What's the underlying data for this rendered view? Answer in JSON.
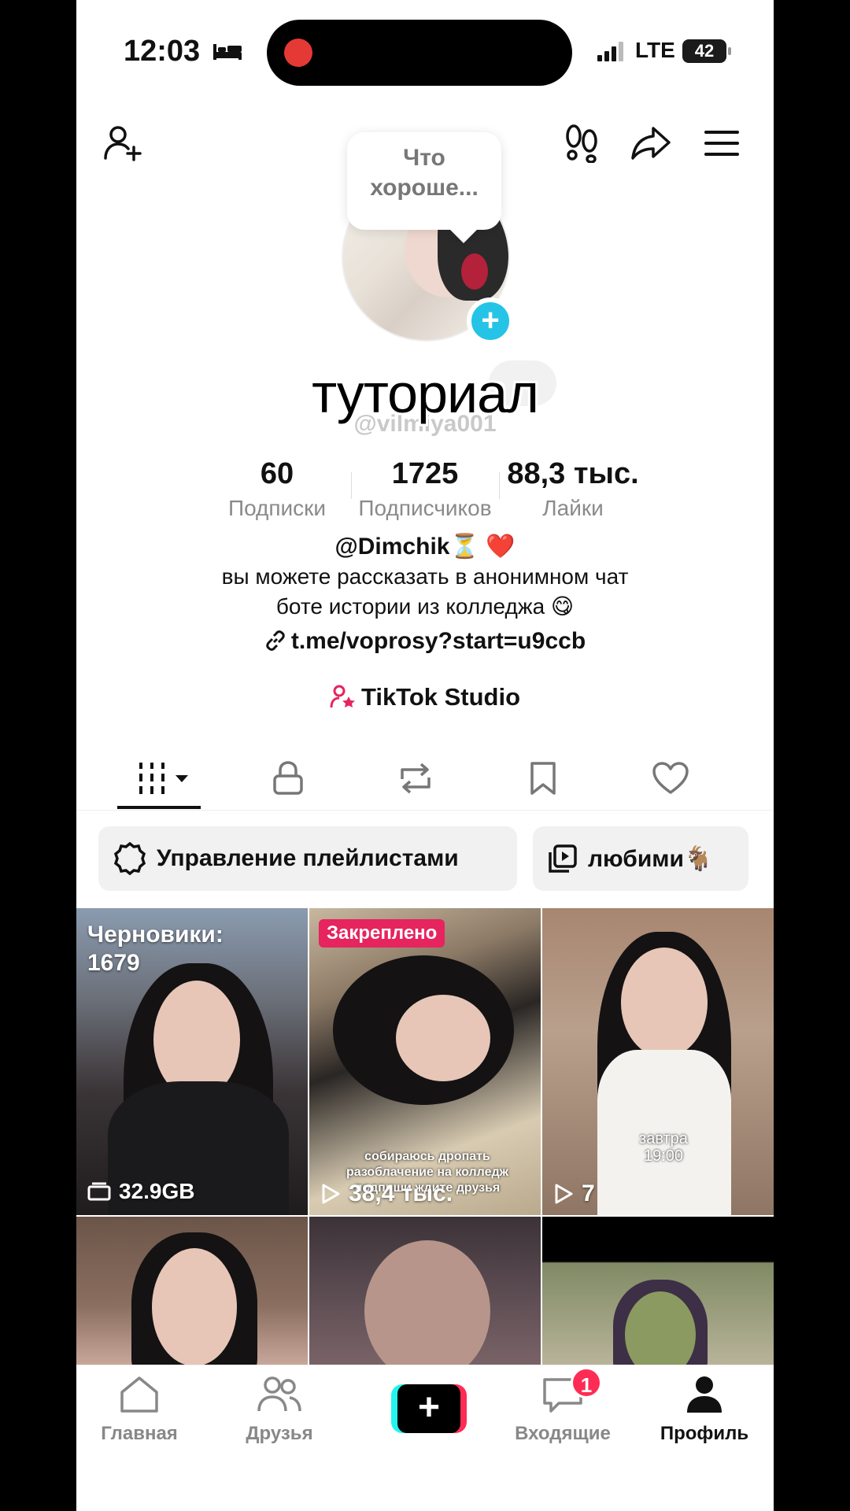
{
  "status_bar": {
    "time": "12:03",
    "network": "LTE",
    "battery": "42"
  },
  "profile": {
    "bubble_text": "Что хороше...",
    "display_name": "туториал",
    "username": "@vilmiya001",
    "stats": [
      {
        "value": "60",
        "label": "Подписки"
      },
      {
        "value": "1725",
        "label": "Подписчиков"
      },
      {
        "value": "88,3 тыс.",
        "label": "Лайки"
      }
    ],
    "bio": {
      "line1": "@Dimchik⏳ ❤️",
      "line2": "вы можете рассказать в анонимном чат",
      "line3": "боте истории из колледжа 😋",
      "link": "t.me/voprosy?start=u9ccb"
    },
    "studio_label": "TikTok Studio"
  },
  "chips": {
    "playlist": "Управление плейлистами",
    "favorites": "любими🐐"
  },
  "videos": [
    {
      "overlay_top": "Черновики: 1679",
      "overlay_bottom": "32.9GB"
    },
    {
      "badge": "Закреплено",
      "caption": "собираюсь дропать разоблачение на колледж подпиши ждите друзья",
      "views": "38,4 тыс."
    },
    {
      "caption": "завтра 19:00",
      "views": "7"
    }
  ],
  "bottom_nav": {
    "home": "Главная",
    "friends": "Друзья",
    "inbox": "Входящие",
    "inbox_badge": "1",
    "profile": "Профиль"
  },
  "colors": {
    "accent_pink": "#fe2c55",
    "accent_cyan": "#25f4ee",
    "avatar_plus": "#25c4e6",
    "studio_pink": "#e6245e"
  }
}
